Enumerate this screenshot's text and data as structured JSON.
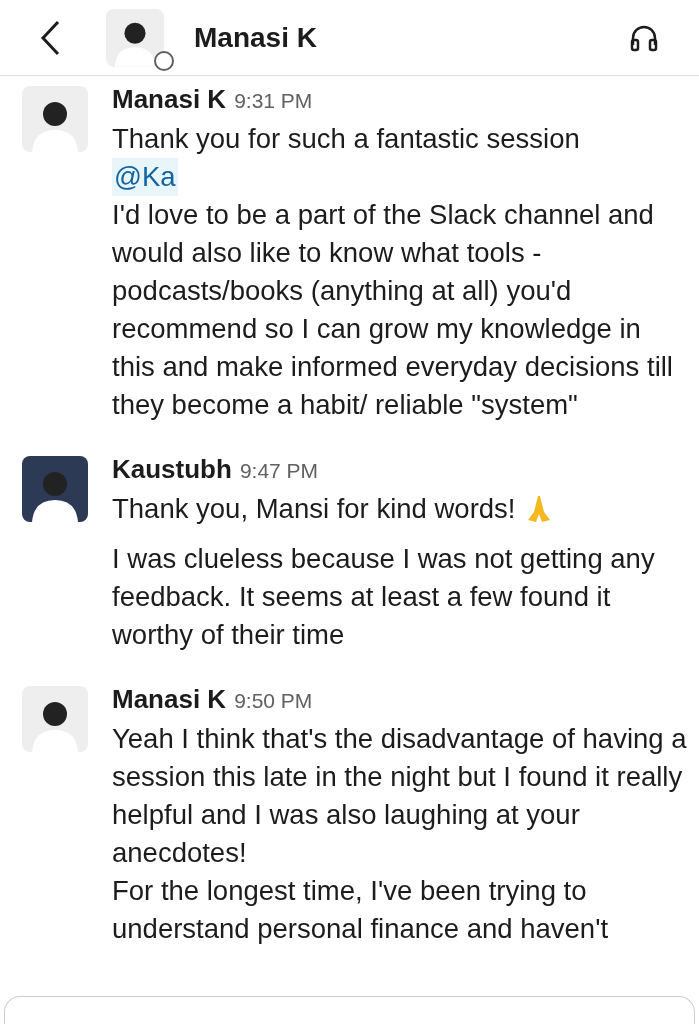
{
  "header": {
    "title": "Manasi K",
    "online": false
  },
  "messages": [
    {
      "author": "Manasi K",
      "time": "9:31 PM",
      "color": "#eeeeee",
      "paragraphs": [
        {
          "kind": "text",
          "text": "Thank you for such a fantastic session"
        },
        {
          "kind": "mention",
          "text": "@Ka"
        },
        {
          "kind": "text",
          "text": "I'd love to be a part of the Slack channel and would also like to know what tools - podcasts/books (anything at all) you'd recommend so I can grow my knowledge in this and make informed everyday decisions till they become a habit/ reliable \"system\""
        }
      ]
    },
    {
      "author": "Kaustubh",
      "time": "9:47 PM",
      "color": "#2c3a55",
      "paragraphs": [
        {
          "kind": "emoji",
          "text": "Thank you, Mansi for kind words!"
        },
        {
          "kind": "gap",
          "text": "I was clueless because I was not getting any feedback. It seems at least a few found it worthy of their time"
        }
      ]
    },
    {
      "author": "Manasi K",
      "time": "9:50 PM",
      "color": "#eeeeee",
      "paragraphs": [
        {
          "kind": "text",
          "text": "Yeah I think that's the disadvantage of having a session this late in the night but I found it really helpful and I was also laughing at your anecdotes!"
        },
        {
          "kind": "text",
          "text": "For the longest time, I've been trying to understand personal finance and haven't"
        }
      ]
    }
  ]
}
